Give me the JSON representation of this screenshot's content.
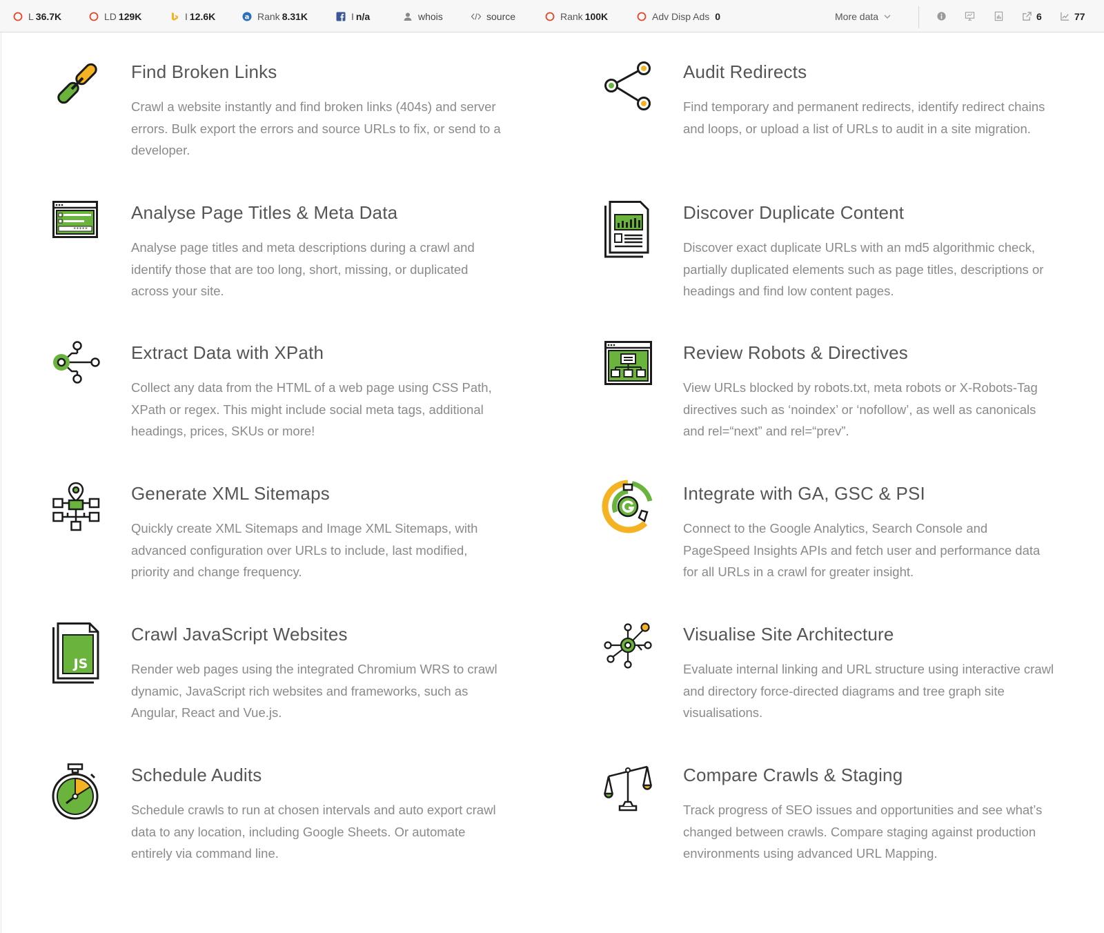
{
  "toolbar": {
    "items": [
      {
        "label": "L",
        "value": "36.7K",
        "icon": "circle-icon"
      },
      {
        "label": "LD",
        "value": "129K",
        "icon": "circle-icon"
      },
      {
        "label": "I",
        "value": "12.6K",
        "icon": "bing-icon"
      },
      {
        "label": "Rank",
        "value": "8.31K",
        "icon": "alexa-icon"
      },
      {
        "label": "I",
        "value": "n/a",
        "icon": "facebook-icon"
      },
      {
        "label": "whois",
        "value": "",
        "icon": "user-icon"
      },
      {
        "label": "source",
        "value": "",
        "icon": "code-icon"
      },
      {
        "label": "Rank",
        "value": "100K",
        "icon": "circle-icon"
      },
      {
        "label": "Adv Disp Ads",
        "value": "0",
        "icon": "circle-icon"
      }
    ],
    "more_label": "More data",
    "right_icons": [
      {
        "icon": "info-icon",
        "count": ""
      },
      {
        "icon": "presentation-icon",
        "count": ""
      },
      {
        "icon": "document-icon",
        "count": ""
      },
      {
        "icon": "external-link-icon",
        "count": "6"
      },
      {
        "icon": "chart-icon",
        "count": "77"
      }
    ],
    "colors": {
      "accent": "#e0462b"
    }
  },
  "features": [
    {
      "title": "Find Broken Links",
      "desc": "Crawl a website instantly and find broken links (404s) and server errors. Bulk export the errors and source URLs to fix, or send to a developer.",
      "icon": "broken-link-icon"
    },
    {
      "title": "Audit Redirects",
      "desc": "Find temporary and permanent redirects, identify redirect chains and loops, or upload a list of URLs to audit in a site migration.",
      "icon": "redirect-icon"
    },
    {
      "title": "Analyse Page Titles & Meta Data",
      "desc": "Analyse page titles and meta descriptions during a crawl and identify those that are too long, short, missing, or duplicated across your site.",
      "icon": "browser-window-icon"
    },
    {
      "title": "Discover Duplicate Content",
      "desc": "Discover exact duplicate URLs with an md5 algorithmic check, partially duplicated elements such as page titles, descriptions or headings and find low content pages.",
      "icon": "duplicate-document-icon"
    },
    {
      "title": "Extract Data with XPath",
      "desc": "Collect any data from the HTML of a web page using CSS Path, XPath or regex. This might include social meta tags, additional headings, prices, SKUs or more!",
      "icon": "xpath-nodes-icon"
    },
    {
      "title": "Review Robots & Directives",
      "desc": "View URLs blocked by robots.txt, meta robots or X-Robots-Tag directives such as ‘noindex’ or ‘nofollow’, as well as canonicals and rel=“next” and rel=“prev”.",
      "icon": "robots-window-icon"
    },
    {
      "title": "Generate XML Sitemaps",
      "desc": "Quickly create XML Sitemaps and Image XML Sitemaps, with advanced configuration over URLs to include, last modified, priority and change frequency.",
      "icon": "sitemap-icon"
    },
    {
      "title": "Integrate with GA, GSC & PSI",
      "desc": "Connect to the Google Analytics, Search Console and PageSpeed Insights APIs and fetch user and performance data for all URLs in a crawl for greater insight.",
      "icon": "google-gauge-icon"
    },
    {
      "title": "Crawl JavaScript Websites",
      "desc": "Render web pages using the integrated Chromium WRS to crawl dynamic, JavaScript rich websites and frameworks, such as Angular, React and Vue.js.",
      "icon": "javascript-file-icon",
      "icon_text": "JS"
    },
    {
      "title": "Visualise Site Architecture",
      "desc": "Evaluate internal linking and URL structure using interactive crawl and directory force-directed diagrams and tree graph site visualisations.",
      "icon": "site-architecture-icon"
    },
    {
      "title": "Schedule Audits",
      "desc": "Schedule crawls to run at chosen intervals and auto export crawl data to any location, including Google Sheets. Or automate entirely via command line.",
      "icon": "stopwatch-icon"
    },
    {
      "title": "Compare Crawls & Staging",
      "desc": "Track progress of SEO issues and opportunities and see what’s changed between crawls. Compare staging against production environments using advanced URL Mapping.",
      "icon": "scales-icon"
    }
  ],
  "colors": {
    "green": "#6ab43e",
    "orange": "#f5b324",
    "dark": "#1b1b1b",
    "title": "#555555",
    "text": "#8a8a8a"
  }
}
